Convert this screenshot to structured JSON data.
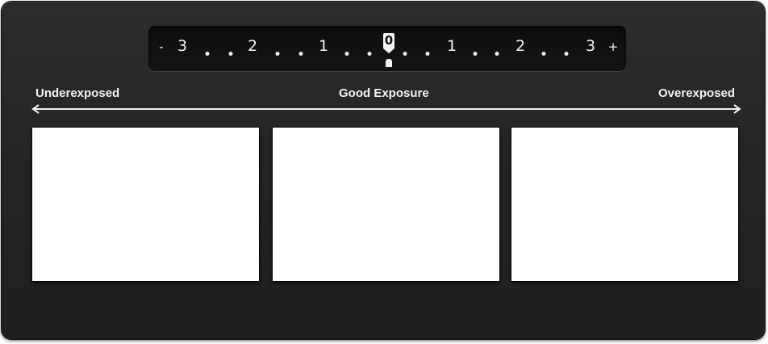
{
  "meter": {
    "minus_sign": "-",
    "plus_sign": "+",
    "left_numbers": [
      "3",
      "2",
      "1"
    ],
    "right_numbers": [
      "1",
      "2",
      "3"
    ],
    "center_value": "0"
  },
  "scale": {
    "left_label": "Underexposed",
    "center_label": "Good Exposure",
    "right_label": "Overexposed"
  },
  "frames": [
    {
      "name": "underexposed-example"
    },
    {
      "name": "good-exposure-example"
    },
    {
      "name": "overexposed-example"
    }
  ],
  "colors": {
    "panel_background": "#262626",
    "meter_background": "#111111",
    "text": "#f2f2f2",
    "frame_fill": "#ffffff"
  }
}
